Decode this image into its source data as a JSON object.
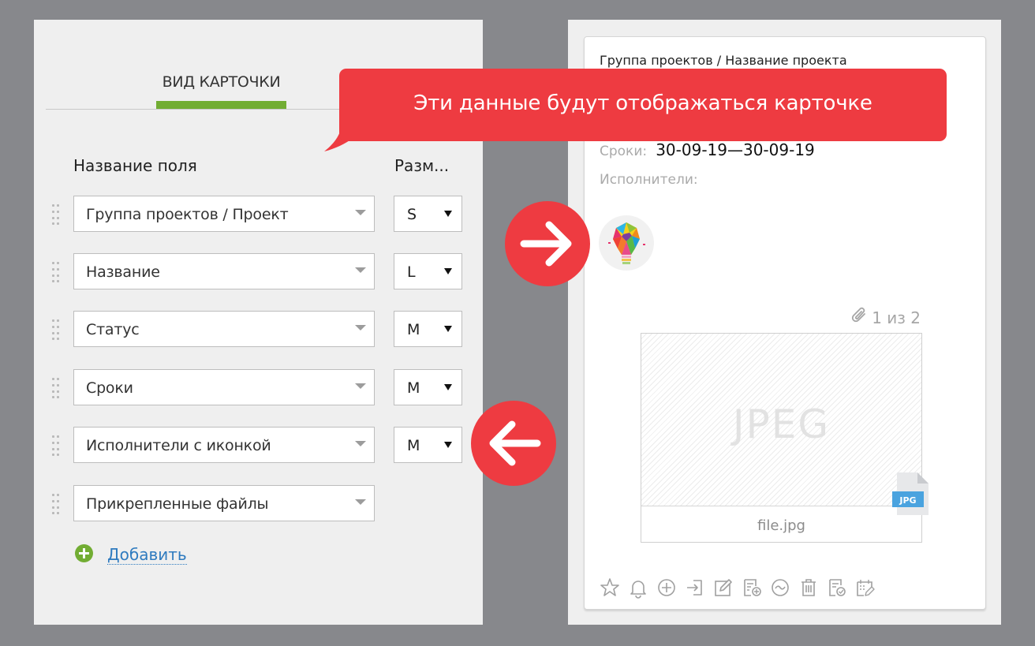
{
  "settings": {
    "tab_title": "ВИД КАРТОЧКИ",
    "columns": {
      "field_name": "Название поля",
      "size": "Разм..."
    },
    "fields": [
      {
        "label": "Группа проектов / Проект",
        "size": "S"
      },
      {
        "label": "Название",
        "size": "L"
      },
      {
        "label": "Статус",
        "size": "M"
      },
      {
        "label": "Сроки",
        "size": "M"
      },
      {
        "label": "Исполнители с иконкой",
        "size": "M"
      },
      {
        "label": "Прикрепленные файлы",
        "size": null
      }
    ],
    "add_label": "Добавить"
  },
  "tooltip": {
    "text": "Эти данные будут отображаться карточке"
  },
  "card": {
    "breadcrumb": "Группа проектов / Название проекта",
    "dates_label": "Сроки:",
    "dates_value": "30-09-19—30-09-19",
    "assignees_label": "Исполнители:",
    "attachments_count": "1 из 2",
    "file_preview_text": "JPEG",
    "file_badge": "JPG",
    "file_name": "file.jpg",
    "actions": [
      "star-icon",
      "bell-icon",
      "plus-circle-icon",
      "login-icon",
      "edit-icon",
      "add-document-icon",
      "wave-circle-icon",
      "trash-icon",
      "checklist-icon",
      "calendar-edit-icon"
    ]
  },
  "colors": {
    "accent_red": "#ee3b41",
    "accent_green": "#72ad33",
    "link_blue": "#2f7bbf",
    "background_gray": "#87888c"
  }
}
